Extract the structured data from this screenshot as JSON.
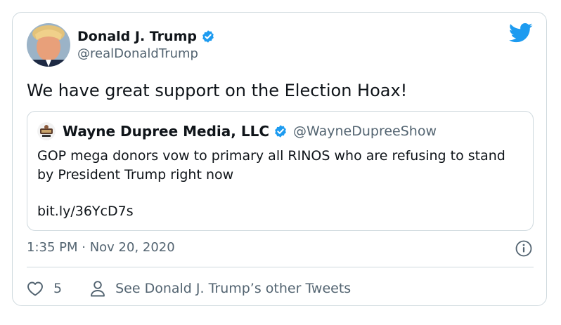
{
  "tweet": {
    "author_name": "Donald J. Trump",
    "author_handle": "@realDonaldTrump",
    "text": "We have great support on the Election Hoax!",
    "timestamp": "1:35 PM · Nov 20, 2020",
    "like_count": "5",
    "other_tweets_label": "See Donald J. Trump’s other Tweets"
  },
  "quoted": {
    "author_name": "Wayne Dupree Media, LLC",
    "author_handle": "@WayneDupreeShow",
    "text": "GOP mega donors vow to primary all RINOS who are refusing to stand by President Trump right now",
    "link": "bit.ly/36YcD7s"
  },
  "colors": {
    "twitter_blue": "#1d9bf0",
    "secondary_text": "#536471",
    "border": "#cfd9de"
  },
  "icons": [
    "verified-badge-icon",
    "twitter-bird-icon",
    "info-icon",
    "heart-icon",
    "person-icon"
  ]
}
